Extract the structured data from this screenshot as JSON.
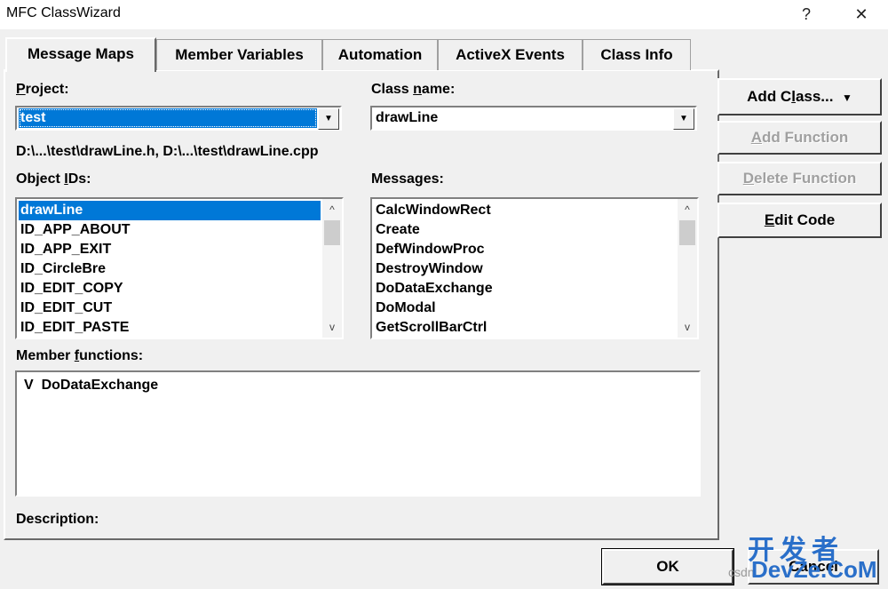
{
  "window": {
    "title": "MFC ClassWizard",
    "help_glyph": "?",
    "close_glyph": "✕"
  },
  "tabs": [
    {
      "label": "Message Maps",
      "active": true
    },
    {
      "label": "Member Variables",
      "active": false
    },
    {
      "label": "Automation",
      "active": false
    },
    {
      "label": "ActiveX Events",
      "active": false
    },
    {
      "label": "Class Info",
      "active": false
    }
  ],
  "project": {
    "label_pre": "",
    "label_key": "P",
    "label_post": "roject:",
    "value": "test"
  },
  "class_name": {
    "label_pre": "Class ",
    "label_key": "n",
    "label_post": "ame:",
    "value": "drawLine"
  },
  "files_path": "D:\\...\\test\\drawLine.h, D:\\...\\test\\drawLine.cpp",
  "object_ids": {
    "label_pre": "Object ",
    "label_key": "I",
    "label_post": "Ds:",
    "items": [
      "drawLine",
      "ID_APP_ABOUT",
      "ID_APP_EXIT",
      "ID_CircleBre",
      "ID_EDIT_COPY",
      "ID_EDIT_CUT",
      "ID_EDIT_PASTE"
    ],
    "selected_index": 0
  },
  "messages": {
    "label_pre": "Messa",
    "label_key": "g",
    "label_post": "es:",
    "items": [
      "CalcWindowRect",
      "Create",
      "DefWindowProc",
      "DestroyWindow",
      "DoDataExchange",
      "DoModal",
      "GetScrollBarCtrl"
    ]
  },
  "member_functions": {
    "label_pre": "Member ",
    "label_key": "f",
    "label_post": "unctions:",
    "items": [
      {
        "marker": "V",
        "name": "DoDataExchange"
      }
    ]
  },
  "description_label": "Description:",
  "buttons": {
    "add_class": {
      "pre": "Add C",
      "key": "l",
      "post": "ass...",
      "arrow": "▼"
    },
    "add_function": {
      "pre": "",
      "key": "A",
      "post": "dd Function",
      "disabled": true
    },
    "delete_function": {
      "pre": "",
      "key": "D",
      "post": "elete Function",
      "disabled": true
    },
    "edit_code": {
      "pre": "",
      "key": "E",
      "post": "dit Code",
      "disabled": false
    },
    "ok": "OK",
    "cancel": "Cancel"
  },
  "scroll": {
    "up": "^",
    "down": "v"
  },
  "watermark": {
    "cn": "开发者",
    "en": "DevZe.CoM",
    "small": "csdn"
  }
}
